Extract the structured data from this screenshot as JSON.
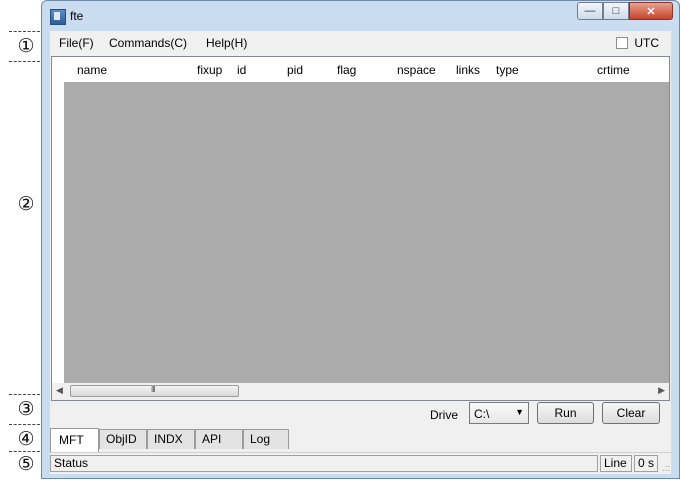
{
  "callouts": [
    "①",
    "②",
    "③",
    "④",
    "⑤"
  ],
  "window": {
    "title": "fte",
    "icons": {
      "app": "app-icon",
      "minimize": "minimize-icon",
      "maximize": "maximize-icon",
      "close": "close-icon"
    }
  },
  "menu": {
    "items": [
      "File(F)",
      "Commands(C)",
      "Help(H)"
    ],
    "utc_label": "UTC",
    "utc_checked": false
  },
  "grid": {
    "columns": [
      "name",
      "fixup",
      "id",
      "pid",
      "flag",
      "nspace",
      "links",
      "type",
      "crtime"
    ],
    "scroll_grip": "III"
  },
  "controls": {
    "drive_label": "Drive",
    "drive_value": "C:\\",
    "run_label": "Run",
    "clear_label": "Clear"
  },
  "tabs": [
    "MFT",
    "ObjID",
    "INDX",
    "API",
    "Log"
  ],
  "active_tab": "MFT",
  "statusbar": {
    "status": "Status",
    "line": "Line",
    "time": "0 s"
  }
}
